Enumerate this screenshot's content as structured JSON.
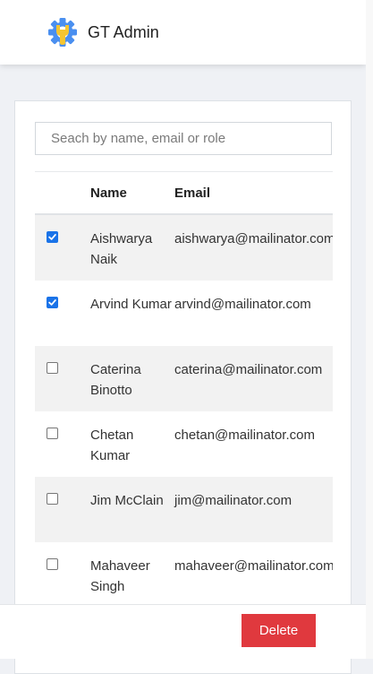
{
  "header": {
    "title": "GT Admin",
    "logo_icon": "gear-wrench-icon",
    "logo_colors": {
      "gear": "#4a8ff0",
      "wrench": "#f5c531"
    }
  },
  "search": {
    "placeholder": "Seach by name, email or role",
    "value": ""
  },
  "table": {
    "columns": [
      "",
      "Name",
      "Email"
    ],
    "rows": [
      {
        "checked": true,
        "name": "Aishwarya Naik",
        "email": "aishwarya@mailinator.com"
      },
      {
        "checked": true,
        "name": "Arvind Kumar",
        "email": "arvind@mailinator.com"
      },
      {
        "checked": false,
        "name": "Caterina Binotto",
        "email": "caterina@mailinator.com"
      },
      {
        "checked": false,
        "name": "Chetan Kumar",
        "email": "chetan@mailinator.com"
      },
      {
        "checked": false,
        "name": "Jim McClain",
        "email": "jim@mailinator.com"
      },
      {
        "checked": false,
        "name": "Mahaveer Singh",
        "email": "mahaveer@mailinator.com"
      }
    ]
  },
  "footer": {
    "delete_label": "Delete",
    "delete_color": "#e0393e"
  }
}
